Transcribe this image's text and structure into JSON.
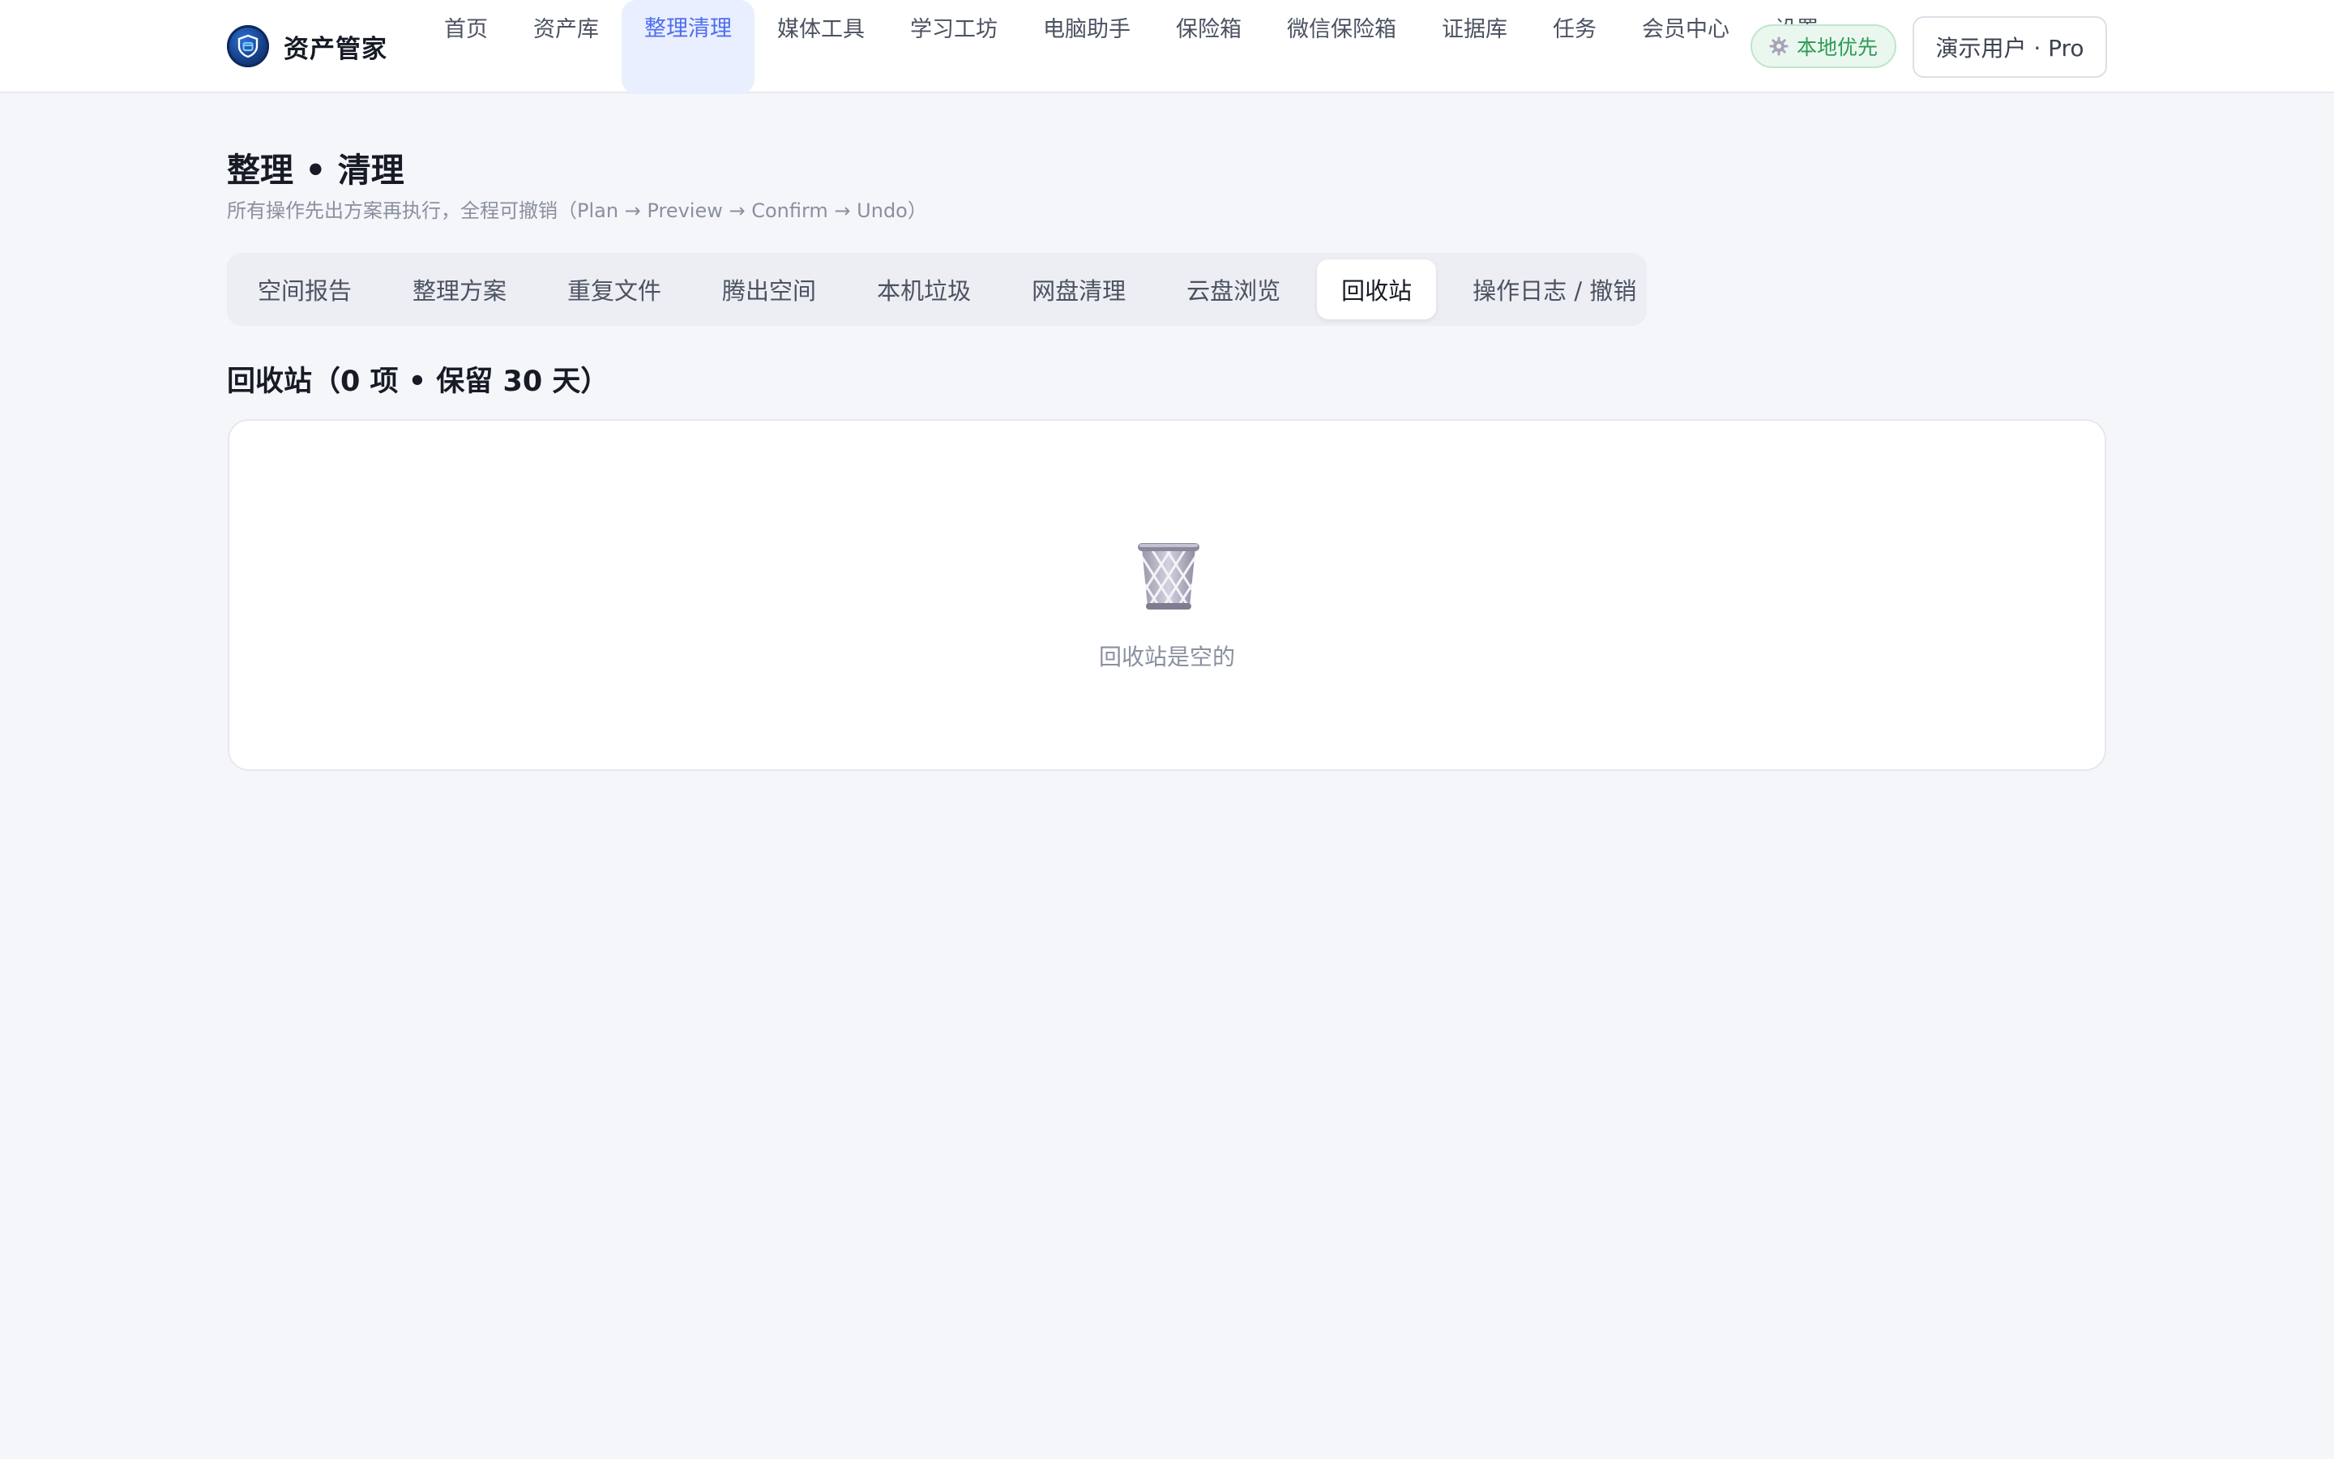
{
  "app": {
    "name": "资产管家"
  },
  "nav": {
    "items": [
      {
        "label": "首页"
      },
      {
        "label": "资产库"
      },
      {
        "label": "整理清理"
      },
      {
        "label": "媒体工具"
      },
      {
        "label": "学习工坊"
      },
      {
        "label": "电脑助手"
      },
      {
        "label": "保险箱"
      },
      {
        "label": "微信保险箱"
      },
      {
        "label": "证据库"
      },
      {
        "label": "任务"
      },
      {
        "label": "会员中心"
      },
      {
        "label": "设置"
      }
    ],
    "active_index": 2
  },
  "header": {
    "local_badge": "本地优先",
    "user_label": "演示用户 · Pro"
  },
  "page": {
    "title": "整理 • 清理",
    "subtitle": "所有操作先出方案再执行，全程可撤销（Plan → Preview → Confirm → Undo）"
  },
  "tabs": {
    "items": [
      {
        "label": "空间报告"
      },
      {
        "label": "整理方案"
      },
      {
        "label": "重复文件"
      },
      {
        "label": "腾出空间"
      },
      {
        "label": "本机垃圾"
      },
      {
        "label": "网盘清理"
      },
      {
        "label": "云盘浏览"
      },
      {
        "label": "回收站"
      },
      {
        "label": "操作日志 / 撤销"
      }
    ],
    "active_index": 7
  },
  "section": {
    "title": "回收站（0 项 • 保留 30 天）",
    "empty_text": "回收站是空的",
    "empty_icon": "wastebasket-icon"
  },
  "colors": {
    "accent": "#4d6ef0",
    "accent_bg": "#eaefff",
    "badge_green": "#2f9a55",
    "page_bg": "#f5f6fa"
  }
}
